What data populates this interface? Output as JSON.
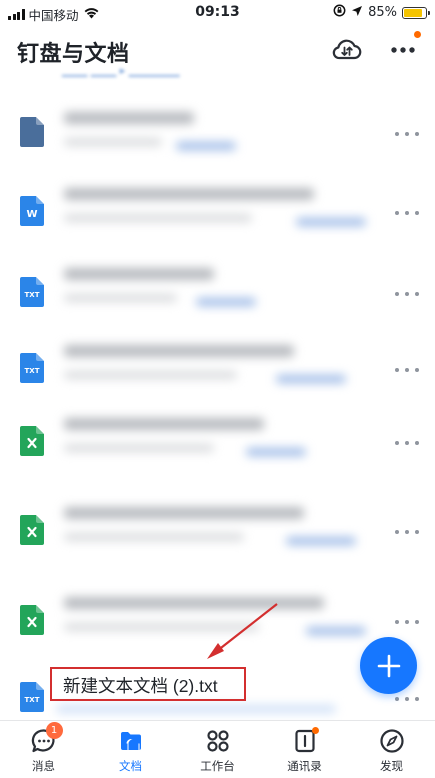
{
  "status_bar": {
    "carrier": "中国移动",
    "time": "09:13",
    "battery": "85%",
    "battery_level": 0.85
  },
  "header": {
    "title": "钉盘与文档"
  },
  "file_list": [
    {
      "type": "doc-file-icon",
      "color": "#4a6e9b"
    },
    {
      "type": "word-file-icon",
      "color": "#2b85e8"
    },
    {
      "type": "txt-file-icon",
      "color": "#2b85e8"
    },
    {
      "type": "txt-file-icon",
      "color": "#2b85e8"
    },
    {
      "type": "excel-file-icon",
      "color": "#23a55a"
    },
    {
      "type": "excel-file-icon",
      "color": "#23a55a"
    },
    {
      "type": "excel-file-icon",
      "color": "#23a55a"
    },
    {
      "type": "txt-file-icon",
      "color": "#2b85e8",
      "name": "新建文本文档 (2).txt"
    }
  ],
  "tabs": [
    {
      "label": "消息",
      "icon": "message-icon",
      "badge": "1"
    },
    {
      "label": "文档",
      "icon": "docs-icon",
      "active": true
    },
    {
      "label": "工作台",
      "icon": "workbench-icon"
    },
    {
      "label": "通讯录",
      "icon": "contacts-icon"
    },
    {
      "label": "发现",
      "icon": "discover-icon"
    }
  ],
  "colors": {
    "accent": "#1677ff",
    "highlight": "#d32f2f",
    "badge": "#ff6a3d",
    "word_icon": "#2b85e8",
    "excel_icon": "#23a55a",
    "doc_icon": "#4a6e9b"
  }
}
